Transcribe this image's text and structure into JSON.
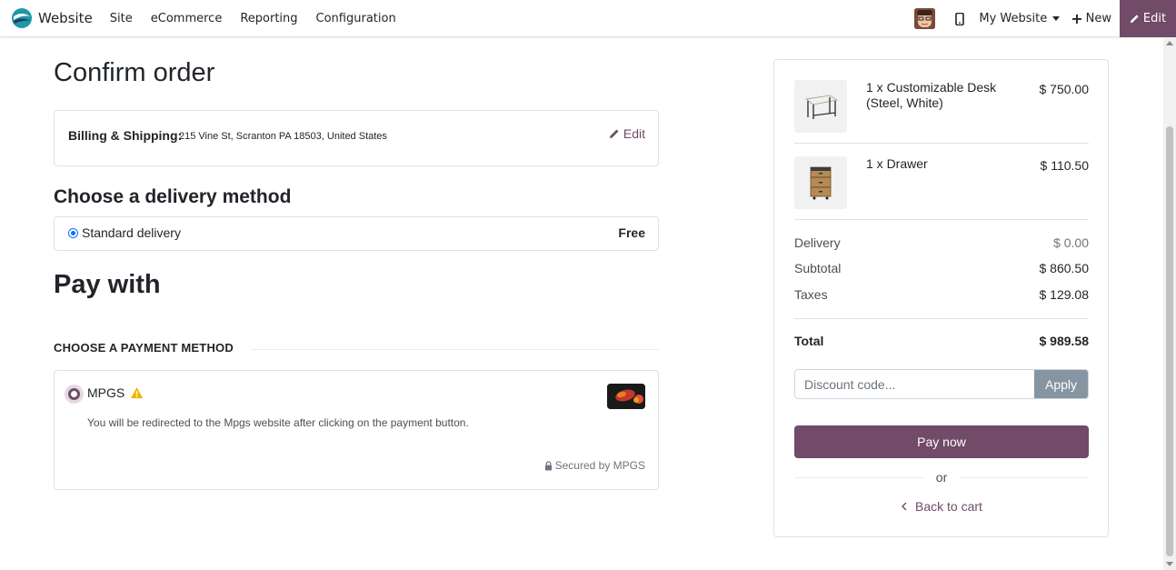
{
  "navbar": {
    "brand": "Website",
    "menu": [
      "Site",
      "eCommerce",
      "Reporting",
      "Configuration"
    ],
    "website_selector": "My Website",
    "new_label": "New",
    "edit_label": "Edit",
    "icons": [
      "website-logo-icon",
      "avatar",
      "mobile-icon",
      "plus-icon",
      "pencil-icon"
    ]
  },
  "checkout": {
    "title": "Confirm order",
    "billing": {
      "label": "Billing & Shipping:",
      "address": "215 Vine St, Scranton PA 18503, United States",
      "edit_label": "Edit"
    },
    "delivery": {
      "title": "Choose a delivery method",
      "method": "Standard delivery",
      "price": "Free"
    },
    "pay": {
      "title": "Pay with",
      "method_heading": "CHOOSE A PAYMENT METHOD",
      "provider": "MPGS",
      "description": "You will be redirected to the Mpgs website after clicking on the payment button.",
      "secured": "Secured by MPGS"
    }
  },
  "summary": {
    "items": [
      {
        "name": "1 x Customizable Desk (Steel, White)",
        "price": "$ 750.00"
      },
      {
        "name": "1 x Drawer",
        "price": "$ 110.50"
      }
    ],
    "delivery_label": "Delivery",
    "delivery_value": "$ 0.00",
    "subtotal_label": "Subtotal",
    "subtotal_value": "$ 860.50",
    "taxes_label": "Taxes",
    "taxes_value": "$ 129.08",
    "total_label": "Total",
    "total_value": "$ 989.58",
    "discount_placeholder": "Discount code...",
    "apply_label": "Apply",
    "pay_now_label": "Pay now",
    "or_label": "or",
    "back_label": "Back to cart"
  },
  "colors": {
    "brand": "#714b67",
    "apply": "#8595a2",
    "radio_blue": "#0d6efd",
    "warning": "#f0b400"
  }
}
